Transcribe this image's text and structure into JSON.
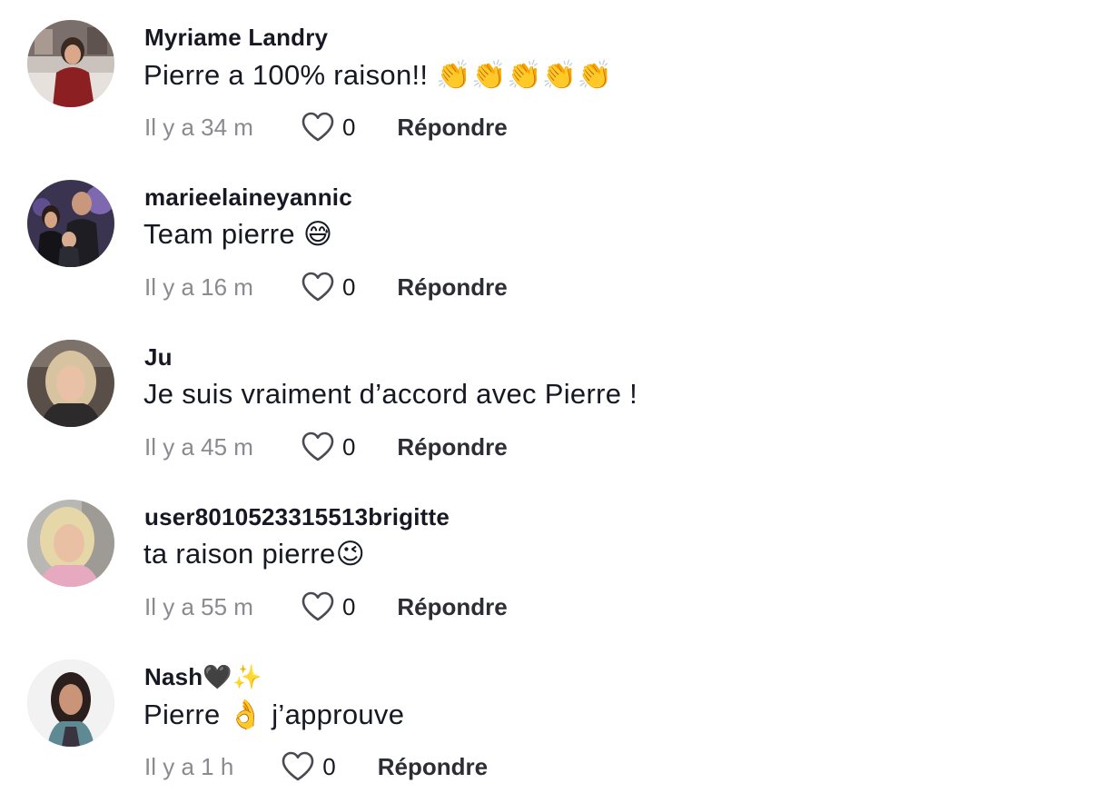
{
  "comments": [
    {
      "username": "Myriame Landry",
      "text": "Pierre a 100% raison!! 👏👏👏👏👏",
      "time": "Il y a 34 m",
      "likes": "0",
      "reply": "Répondre"
    },
    {
      "username": "marieelaineyannic",
      "text": "Team pierre 😅",
      "time": "Il y a 16 m",
      "likes": "0",
      "reply": "Répondre"
    },
    {
      "username": "Ju",
      "text": "Je suis vraiment d’accord avec Pierre !",
      "time": "Il y a 45 m",
      "likes": "0",
      "reply": "Répondre"
    },
    {
      "username": "user8010523315513brigitte",
      "text": "ta raison pierre😉",
      "time": "Il y a 55 m",
      "likes": "0",
      "reply": "Répondre"
    },
    {
      "username": "Nash🖤✨",
      "text": "Pierre 👌 j’approuve",
      "time": "Il y a 1 h",
      "likes": "0",
      "reply": "Répondre"
    }
  ],
  "icons": {
    "like": "heart-outline-icon",
    "avatar": "user-avatar"
  },
  "colors": {
    "text": "#161823",
    "secondary": "#8a8b91",
    "background": "#ffffff"
  }
}
